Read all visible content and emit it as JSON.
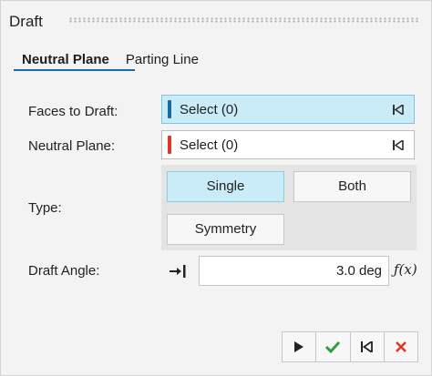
{
  "panel": {
    "title": "Draft"
  },
  "tabs": [
    {
      "label": "Neutral Plane",
      "active": true
    },
    {
      "label": "Parting Line",
      "active": false
    }
  ],
  "fields": {
    "faces_to_draft": {
      "label": "Faces to Draft:",
      "value": "Select (0)",
      "indicator_color": "#1a6aa8",
      "active": true
    },
    "neutral_plane": {
      "label": "Neutral Plane:",
      "value": "Select (0)",
      "indicator_color": "#d93a2b",
      "active": false
    },
    "type": {
      "label": "Type:",
      "options": [
        "Single",
        "Both",
        "Symmetry"
      ],
      "selected": "Single"
    },
    "draft_angle": {
      "label": "Draft Angle:",
      "value": "3.0 deg",
      "fx_label": "ƒ(x)"
    }
  },
  "footer": {
    "buttons": [
      "play-icon",
      "check-icon",
      "skip-back-icon",
      "close-icon"
    ],
    "colors": {
      "check": "#2f9e3a",
      "close": "#d93a2b"
    }
  },
  "colors": {
    "accent": "#1a6aa8",
    "selection_bg": "#c9ecf8"
  }
}
